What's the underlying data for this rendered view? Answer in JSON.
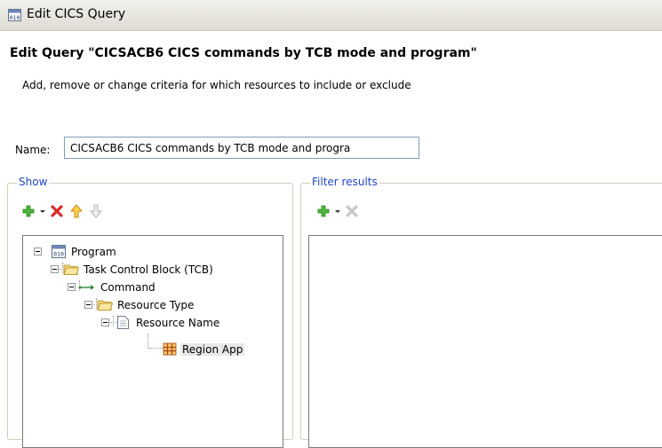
{
  "window": {
    "title": "Edit CICS Query",
    "icon": "binary-program-icon"
  },
  "page": {
    "heading": "Edit Query \"CICSACB6 CICS commands by TCB mode and program\"",
    "subtitle": "Add, remove or change criteria for which resources to include or exclude"
  },
  "name_field": {
    "label": "Name:",
    "value": "CICSACB6 CICS commands by TCB mode and progra"
  },
  "show": {
    "label": "Show",
    "toolbar": [
      "add-icon",
      "dropdown-arrow-icon",
      "delete-icon",
      "move-up-icon",
      "move-down-icon"
    ],
    "tree": [
      {
        "label": "Program",
        "icon": "binary-program-icon",
        "level": 0
      },
      {
        "label": "Task Control Block (TCB)",
        "icon": "folder-icon",
        "level": 1
      },
      {
        "label": "Command",
        "icon": "arrow-icon",
        "level": 2
      },
      {
        "label": "Resource Type",
        "icon": "folder-icon",
        "level": 3
      },
      {
        "label": "Resource Name",
        "icon": "document-icon",
        "level": 4
      },
      {
        "label": "Region App",
        "icon": "grid-icon",
        "level": 5,
        "selected": true
      }
    ]
  },
  "filter": {
    "label": "Filter results",
    "toolbar": [
      "add-icon",
      "dropdown-arrow-icon",
      "delete-icon-disabled"
    ]
  },
  "colors": {
    "group_label": "#1f47c8",
    "add_green": "#3fa52a",
    "delete_red": "#d62b2b",
    "arrow_orange": "#e7a01a"
  }
}
